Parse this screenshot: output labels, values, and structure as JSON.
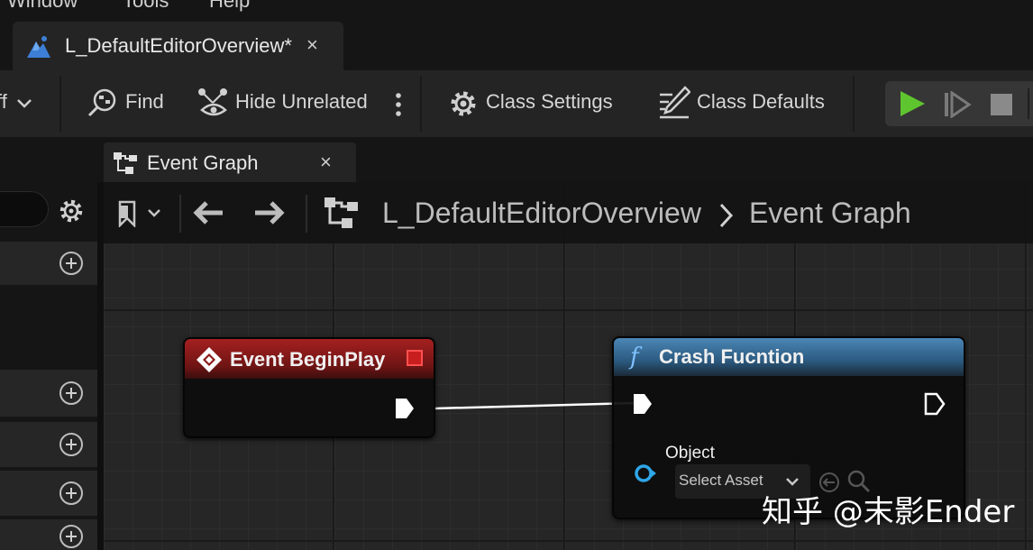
{
  "menubar": {
    "items": [
      "Window",
      "Tools",
      "Help"
    ]
  },
  "document_tab": {
    "title": "L_DefaultEditorOverview*",
    "close": "×",
    "icon": "level-blueprint-icon"
  },
  "toolbar": {
    "cut_label": "ff",
    "find_label": "Find",
    "hide_unrelated_label": "Hide Unrelated",
    "class_settings_label": "Class Settings",
    "class_defaults_label": "Class Defaults",
    "play_color": "#5fc52e"
  },
  "graph_tab": {
    "title": "Event Graph",
    "close": "×"
  },
  "breadcrumb": {
    "level": "L_DefaultEditorOverview",
    "separator": "›",
    "graph": "Event Graph"
  },
  "nodes": {
    "begin_play": {
      "title": "Event BeginPlay",
      "header_color": "#8a1a1a"
    },
    "crash_function": {
      "title": "Crash Fucntion",
      "header_color": "#3b6f96",
      "function_glyph": "f",
      "object_pin_label": "Object",
      "select_asset_label": "Select Asset"
    }
  },
  "watermark": "知乎 @末影Ender"
}
